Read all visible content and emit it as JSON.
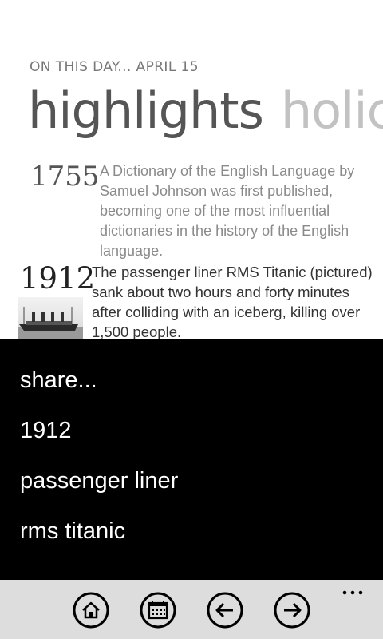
{
  "header": {
    "caption": "ON THIS DAY... APRIL 15"
  },
  "pivot": {
    "items": [
      {
        "label": "highlights"
      },
      {
        "label": "holic"
      }
    ]
  },
  "events": [
    {
      "year": "1755",
      "text": "A Dictionary of the English Language by Samuel Johnson was first published, becoming one of the most influential dictionaries in the history of the English language."
    },
    {
      "year": "1912",
      "text": "The passenger liner RMS Titanic (pictured) sank about two hours and forty minutes after colliding with an iceberg, killing over 1,500 people."
    }
  ],
  "context_menu": {
    "items": [
      {
        "label": "share..."
      },
      {
        "label": "1912"
      },
      {
        "label": "passenger liner"
      },
      {
        "label": "rms titanic"
      }
    ]
  },
  "appbar": {
    "buttons": [
      {
        "icon": "home-icon"
      },
      {
        "icon": "calendar-icon"
      },
      {
        "icon": "back-arrow-icon"
      },
      {
        "icon": "forward-arrow-icon"
      }
    ],
    "more": "..."
  },
  "colors": {
    "menu_background": "#000000",
    "appbar_background": "#dddddd",
    "pivot_active": "#555555",
    "pivot_inactive": "#c2c2c2"
  }
}
